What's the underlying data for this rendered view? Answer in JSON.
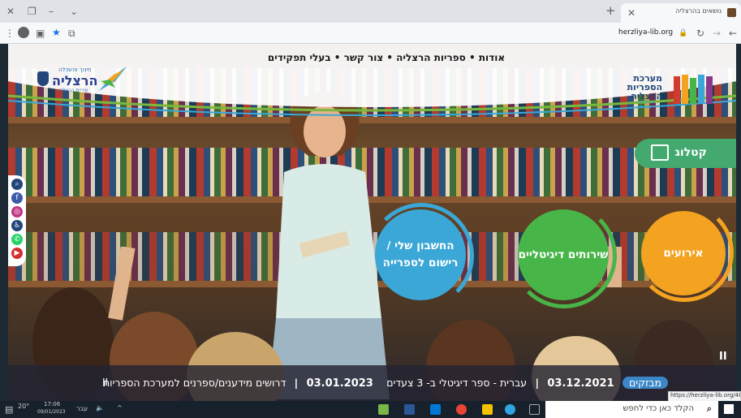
{
  "browser": {
    "tab_title": "נושאים בהרצליה",
    "url": "herzliya-lib.org",
    "window_controls": [
      "close-icon",
      "restore-icon",
      "minimize-icon",
      "dropdown-icon"
    ],
    "toolbar_icons": [
      "menu-icon",
      "profile-icon",
      "sidebar-icon",
      "star-icon",
      "collections-icon"
    ]
  },
  "site": {
    "top_nav": "אודות • ספריות הרצליה • צור קשר • בעלי תפקידים",
    "logo_left": {
      "line1": "חינוך והשכלה",
      "line2": "הרצליה",
      "line3": "עיריית הרצליה"
    },
    "logo_right": {
      "line1": "מערכת",
      "line2": "הספריות",
      "line3": "הרצליה",
      "line4": "herzliya-lib.org"
    },
    "catalog_label": "קטלוג",
    "circles": [
      {
        "id": "account",
        "label": "החשבון שלי / רישום לספרייה"
      },
      {
        "id": "digital",
        "label": "שירותים דיגיטליים"
      },
      {
        "id": "events",
        "label": "אירועים"
      }
    ],
    "social_icons": [
      "search-icon",
      "facebook-icon",
      "instagram-icon",
      "accessibility-icon",
      "whatsapp-icon",
      "youtube-icon"
    ],
    "ticker": {
      "badge": "מבזקים",
      "item1_date": "03.12.2021",
      "item1_text": "עברית - ספר דיגיטלי ב- 3 צעדים",
      "item2_date": "03.01.2023",
      "item2_text": "דרושים מידענים/ספרנים למערכת הספריות"
    },
    "pause_symbol": "II",
    "status_url": "https://herzliya-lib.org/48"
  },
  "taskbar": {
    "search_placeholder": "הקלד כאן כדי לחפש",
    "time": "17:06",
    "date": "09/01/2023",
    "lang": "עבר",
    "temp": "20°"
  },
  "colors": {
    "blue": "#3aa7d6",
    "green": "#48b548",
    "orange": "#f3a31f",
    "catalog": "#43a96f",
    "badge": "#3b87c8"
  }
}
